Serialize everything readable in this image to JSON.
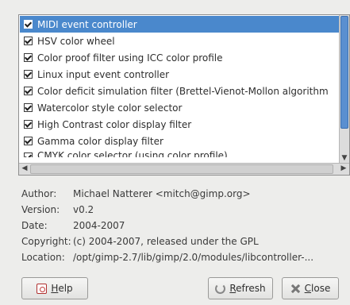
{
  "modules": [
    {
      "label": "MIDI event controller",
      "checked": true,
      "selected": true
    },
    {
      "label": "HSV color wheel",
      "checked": true,
      "selected": false
    },
    {
      "label": "Color proof filter using ICC color profile",
      "checked": true,
      "selected": false
    },
    {
      "label": "Linux input event controller",
      "checked": true,
      "selected": false
    },
    {
      "label": "Color deficit simulation filter (Brettel-Vienot-Mollon algorithm",
      "checked": true,
      "selected": false
    },
    {
      "label": "Watercolor style color selector",
      "checked": true,
      "selected": false
    },
    {
      "label": "High Contrast color display filter",
      "checked": true,
      "selected": false
    },
    {
      "label": "Gamma color display filter",
      "checked": true,
      "selected": false
    },
    {
      "label": "CMYK color selector (using color profile)",
      "checked": true,
      "selected": false
    }
  ],
  "info": {
    "author_key": "Author:",
    "author_value": "Michael Natterer <mitch@gimp.org>",
    "version_key": "Version:",
    "version_value": "v0.2",
    "date_key": "Date:",
    "date_value": "2004-2007",
    "copyright_key": "Copyright:",
    "copyright_value": "(c) 2004-2007, released under the GPL",
    "location_key": "Location:",
    "location_value": "/opt/gimp-2.7/lib/gimp/2.0/modules/libcontroller-..."
  },
  "buttons": {
    "help_mnemonic": "H",
    "help_rest": "elp",
    "refresh_mnemonic": "R",
    "refresh_rest": "efresh",
    "close_mnemonic": "C",
    "close_rest": "lose"
  },
  "colors": {
    "selection": "#4a88cc",
    "scroll_thumb": "#5a8fd0",
    "background": "#ededeb"
  }
}
